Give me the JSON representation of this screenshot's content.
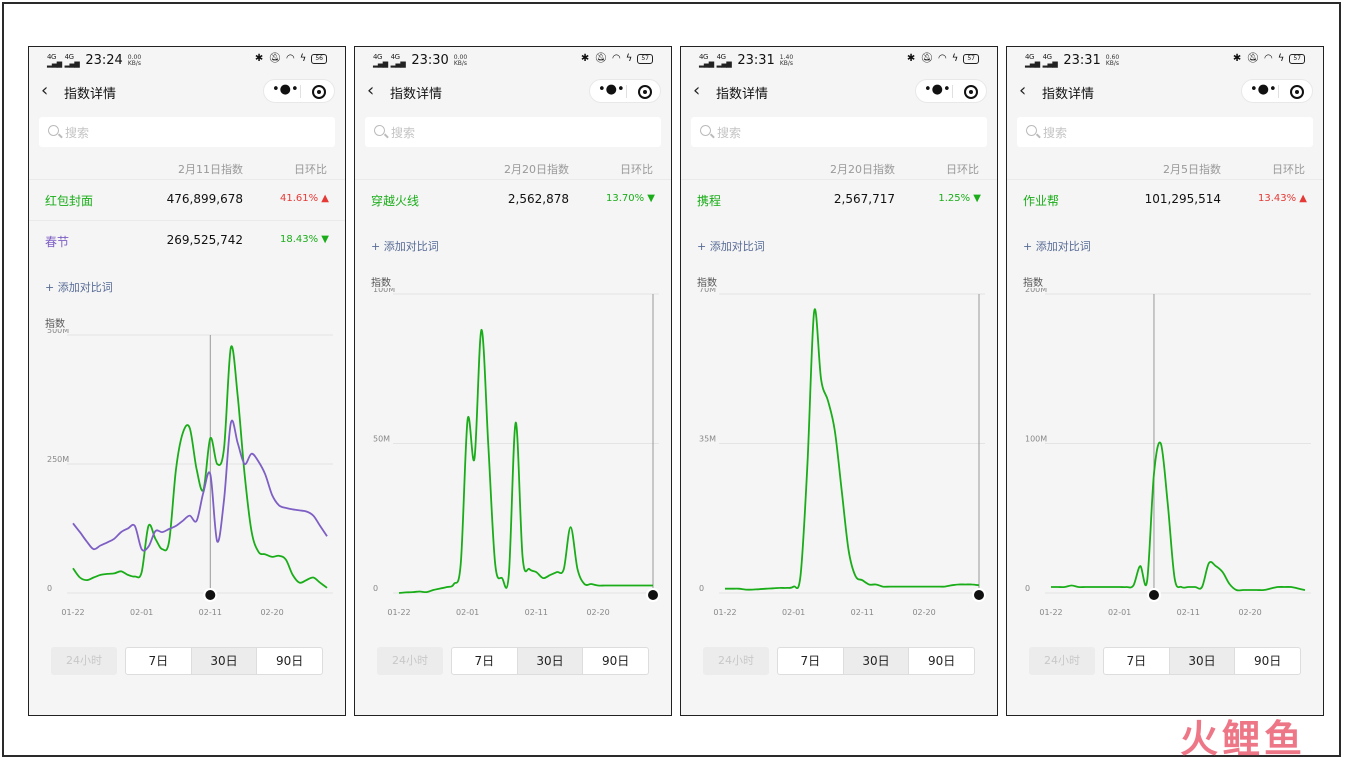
{
  "shared": {
    "search_placeholder": "搜索",
    "nav_title": "指数详情",
    "change_header": "日环比",
    "add_compare": "+ 添加对比词",
    "y_axis_title": "指数",
    "range_buttons": [
      "24小时",
      "7日",
      "30日",
      "90日"
    ],
    "active_range": "30日",
    "x_ticks": [
      "01-22",
      "02-01",
      "02-11",
      "02-20"
    ],
    "up_color": "#e53935",
    "down_color": "#1aad19",
    "series_green": "#1aad19",
    "series_purple": "#7e5fc4"
  },
  "phones": [
    {
      "status": {
        "time": "23:24",
        "speed_top": "0.00",
        "speed_bottom": "KB/s",
        "battery": "56"
      },
      "date_header": "2月11日指数",
      "rows": [
        {
          "name": "红包封面",
          "value": "476,899,678",
          "change": "41.61%",
          "arrow": "▲",
          "dir": "up",
          "color": "#1aad19"
        },
        {
          "name": "春节",
          "value": "269,525,742",
          "change": "18.43%",
          "arrow": "▼",
          "dir": "down",
          "color": "#7e5fc4"
        }
      ],
      "chart_data": {
        "type": "line",
        "x_ticks": [
          "01-22",
          "02-01",
          "02-11",
          "02-20"
        ],
        "y_ticks": [
          "0",
          "250M",
          "500M"
        ],
        "ylim": [
          0,
          500
        ],
        "unit": "M",
        "cursor_day": 20,
        "series": [
          {
            "name": "红包封面",
            "color": "#1aad19",
            "values": [
              48,
              30,
              25,
              30,
              35,
              37,
              38,
              42,
              35,
              32,
              40,
              130,
              105,
              85,
              100,
              240,
              310,
              320,
              240,
              200,
              300,
              250,
              280,
              476,
              380,
              230,
              120,
              80,
              75,
              70,
              72,
              65,
              35,
              20,
              25,
              30,
              20,
              10
            ]
          },
          {
            "name": "春节",
            "color": "#7e5fc4",
            "values": [
              135,
              118,
              100,
              85,
              92,
              98,
              105,
              118,
              125,
              130,
              85,
              90,
              120,
              118,
              124,
              130,
              140,
              150,
              140,
              195,
              230,
              100,
              180,
              330,
              290,
              250,
              270,
              255,
              230,
              190,
              170,
              165,
              162,
              160,
              158,
              150,
              130,
              110
            ]
          }
        ]
      }
    },
    {
      "status": {
        "time": "23:30",
        "speed_top": "0.00",
        "speed_bottom": "KB/s",
        "battery": "57"
      },
      "date_header": "2月20日指数",
      "rows": [
        {
          "name": "穿越火线",
          "value": "2,562,878",
          "change": "13.70%",
          "arrow": "▼",
          "dir": "down",
          "color": "#1aad19"
        }
      ],
      "chart_data": {
        "type": "line",
        "x_ticks": [
          "01-22",
          "02-01",
          "02-11",
          "02-20"
        ],
        "y_ticks": [
          "0",
          "50M",
          "100M"
        ],
        "ylim": [
          0,
          100
        ],
        "unit": "M",
        "cursor_day": 37,
        "series": [
          {
            "name": "穿越火线",
            "color": "#1aad19",
            "values": [
              0,
              0.2,
              0.3,
              0.5,
              0.3,
              1,
              1.5,
              2,
              3,
              10,
              58,
              45,
              88,
              50,
              10,
              5,
              6,
              57,
              12,
              8,
              7,
              5,
              6,
              7,
              8,
              22,
              8,
              3,
              3,
              2.5,
              2.5,
              2.5,
              2.5,
              2.5,
              2.5,
              2.5,
              2.5,
              2.5
            ]
          }
        ]
      }
    },
    {
      "status": {
        "time": "23:31",
        "speed_top": "1.40",
        "speed_bottom": "KB/s",
        "battery": "57"
      },
      "date_header": "2月20日指数",
      "rows": [
        {
          "name": "携程",
          "value": "2,567,717",
          "change": "1.25%",
          "arrow": "▼",
          "dir": "down",
          "color": "#1aad19"
        }
      ],
      "chart_data": {
        "type": "line",
        "x_ticks": [
          "01-22",
          "02-01",
          "02-11",
          "02-20"
        ],
        "y_ticks": [
          "0",
          "35M",
          "70M"
        ],
        "ylim": [
          0,
          70
        ],
        "unit": "M",
        "cursor_day": 37,
        "series": [
          {
            "name": "携程",
            "color": "#1aad19",
            "values": [
              1,
              1,
              1,
              0.8,
              0.8,
              0.9,
              1,
              1.1,
              1.2,
              1.2,
              1.5,
              4,
              30,
              66,
              50,
              45,
              38,
              24,
              10,
              4,
              3,
              2,
              2,
              1.5,
              1.5,
              1.5,
              1.5,
              1.5,
              1.5,
              1.5,
              1.5,
              1.5,
              1.5,
              1.8,
              2,
              2,
              2,
              1.8
            ]
          }
        ]
      }
    },
    {
      "status": {
        "time": "23:31",
        "speed_top": "0.60",
        "speed_bottom": "KB/s",
        "battery": "57"
      },
      "date_header": "2月5日指数",
      "rows": [
        {
          "name": "作业帮",
          "value": "101,295,514",
          "change": "13.43%",
          "arrow": "▲",
          "dir": "up",
          "color": "#1aad19"
        }
      ],
      "chart_data": {
        "type": "line",
        "x_ticks": [
          "01-22",
          "02-01",
          "02-11",
          "02-20"
        ],
        "y_ticks": [
          "0",
          "100M",
          "200M"
        ],
        "ylim": [
          0,
          200
        ],
        "unit": "M",
        "cursor_day": 15,
        "series": [
          {
            "name": "作业帮",
            "color": "#1aad19",
            "values": [
              4,
              4,
              4,
              5,
              4,
              4,
              4,
              4,
              4,
              4,
              4,
              4,
              5,
              18,
              8,
              80,
              100,
              60,
              10,
              4,
              4,
              4,
              4,
              20,
              18,
              14,
              6,
              2,
              2,
              2,
              2,
              2,
              3,
              4,
              4,
              4,
              3,
              2
            ]
          }
        ]
      }
    }
  ],
  "watermark": {
    "text": "火鲤鱼"
  }
}
